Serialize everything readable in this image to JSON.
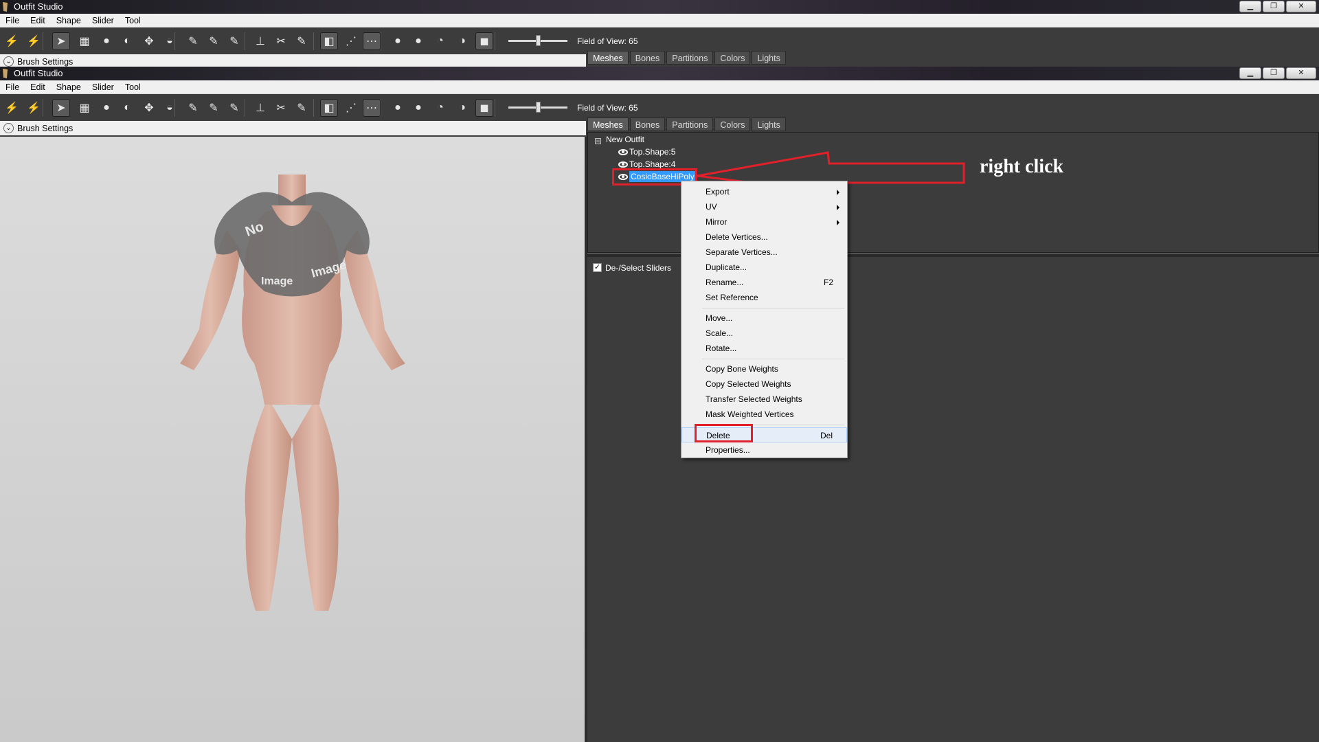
{
  "window": {
    "title": "Outfit Studio"
  },
  "menubar": {
    "items": [
      "File",
      "Edit",
      "Shape",
      "Slider",
      "Tool"
    ]
  },
  "window_buttons": {
    "minimize": "▁",
    "restore": "❐",
    "close": "✕"
  },
  "toolbar": {
    "fov_label": "Field of View: 65",
    "fov_value": 65
  },
  "brush": {
    "label": "Brush Settings"
  },
  "tabs": [
    "Meshes",
    "Bones",
    "Partitions",
    "Colors",
    "Lights"
  ],
  "tree": {
    "root_expander": "−",
    "root": "New Outfit",
    "items": [
      "Top.Shape:5",
      "Top.Shape:4",
      "CosioBaseHiPoly"
    ]
  },
  "context_menu": {
    "items": [
      {
        "label": "Export",
        "submenu": true
      },
      {
        "label": "UV",
        "submenu": true
      },
      {
        "label": "Mirror",
        "submenu": true
      },
      {
        "label": "Delete Vertices..."
      },
      {
        "label": "Separate Vertices..."
      },
      {
        "label": "Duplicate..."
      },
      {
        "label": "Rename...",
        "shortcut": "F2"
      },
      {
        "label": "Set Reference"
      },
      {
        "label": "Move..."
      },
      {
        "label": "Scale..."
      },
      {
        "label": "Rotate..."
      },
      {
        "label": "Copy Bone Weights"
      },
      {
        "label": "Copy Selected Weights"
      },
      {
        "label": "Transfer Selected Weights"
      },
      {
        "label": "Mask Weighted Vertices"
      },
      {
        "label": "Delete",
        "shortcut": "Del"
      },
      {
        "label": "Properties..."
      }
    ]
  },
  "sliders": {
    "label": "De-/Select Sliders",
    "checked": true,
    "check_glyph": "✓"
  },
  "annotation": {
    "text": "right click",
    "color": "#e0202a"
  }
}
